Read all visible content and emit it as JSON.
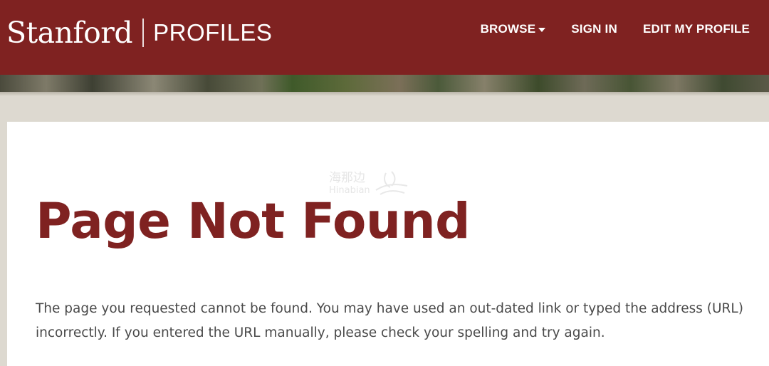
{
  "header": {
    "brand_name": "Stanford",
    "brand_sub": "PROFILES",
    "nav": [
      {
        "label": "BROWSE",
        "has_dropdown": true
      },
      {
        "label": "SIGN IN"
      },
      {
        "label": "EDIT MY PROFILE"
      }
    ]
  },
  "main": {
    "title": "Page Not Found",
    "message": "The page you requested cannot be found. You may have used an out-dated link or typed the address (URL) incorrectly. If you entered the URL manually, please check your spelling and try again."
  },
  "watermark": {
    "text": "海那边",
    "sub": "Hinabian"
  },
  "colors": {
    "brand": "#7f2221",
    "background": "#ddd9d0",
    "card": "#ffffff",
    "text": "#4a4a4a"
  },
  "icons": {
    "browse_dropdown": "caret-down-icon",
    "watermark": "leaf-logo-icon"
  }
}
